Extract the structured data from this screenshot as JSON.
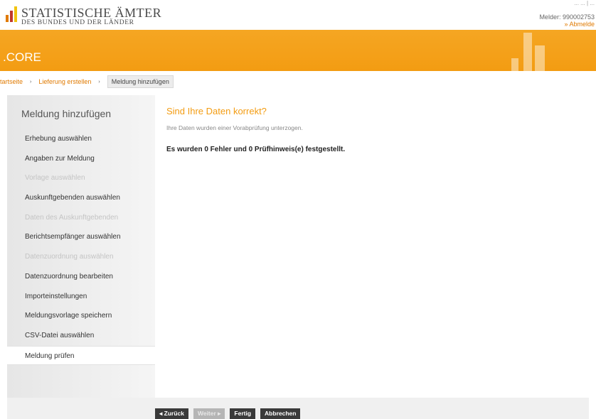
{
  "header": {
    "logo_title": "STATISTISCHE ÄMTER",
    "logo_subtitle": "DES BUNDES UND DER LÄNDER",
    "top_nav": "... ... | ...",
    "user_id": "Melder: 990002753",
    "logout_label": "» Abmelde"
  },
  "banner": {
    "app_name": ".CORE"
  },
  "breadcrumb": {
    "items": [
      "tartseite",
      "Lieferung erstellen",
      "Meldung hinzufügen"
    ],
    "separator": "›"
  },
  "sidebar": {
    "title": "Meldung hinzufügen",
    "items": [
      {
        "label": "Erhebung auswählen",
        "state": "enabled"
      },
      {
        "label": "Angaben zur Meldung",
        "state": "enabled"
      },
      {
        "label": "Vorlage auswählen",
        "state": "disabled"
      },
      {
        "label": "Auskunftgebenden auswählen",
        "state": "enabled"
      },
      {
        "label": "Daten des Auskunftgebenden",
        "state": "disabled"
      },
      {
        "label": "Berichtsempfänger auswählen",
        "state": "enabled"
      },
      {
        "label": "Datenzuordnung auswählen",
        "state": "disabled"
      },
      {
        "label": "Datenzuordnung bearbeiten",
        "state": "enabled"
      },
      {
        "label": "Importeinstellungen",
        "state": "enabled"
      },
      {
        "label": "Meldungsvorlage speichern",
        "state": "enabled"
      },
      {
        "label": "CSV-Datei auswählen",
        "state": "enabled"
      },
      {
        "label": "Meldung prüfen",
        "state": "active"
      }
    ]
  },
  "main": {
    "title": "Sind Ihre Daten korrekt?",
    "intro": "Ihre Daten wurden einer Vorabprüfung unterzogen.",
    "result": "Es wurden 0 Fehler und 0 Prüfhinweis(e) festgestellt."
  },
  "buttons": {
    "back": "◂ Zurück",
    "next": "Weiter ▸",
    "finish": "Fertig",
    "cancel": "Abbrechen"
  },
  "colors": {
    "brand_orange": "#f39c12",
    "link_orange": "#e07a00",
    "button_dark": "#3a3a3a",
    "button_disabled": "#b5b5b5"
  }
}
